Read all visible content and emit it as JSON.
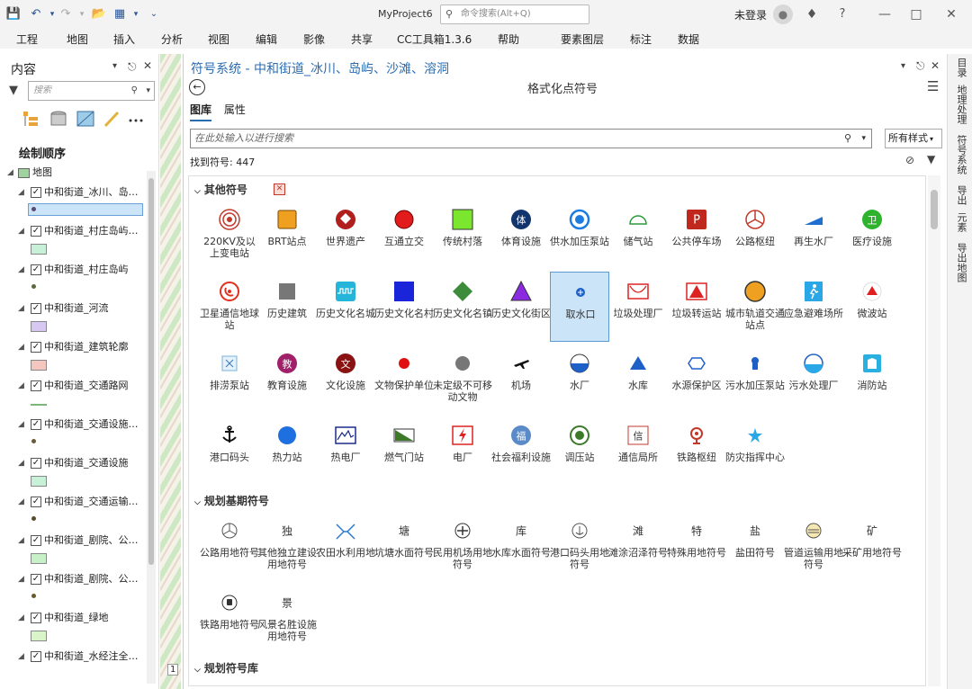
{
  "titlebar": {
    "project": "MyProject6",
    "command_search_placeholder": "命令搜索(Alt+Q)",
    "login": "未登录"
  },
  "ribbon_tabs": [
    "工程",
    "地图",
    "插入",
    "分析",
    "视图",
    "编辑",
    "影像",
    "共享",
    "CC工具箱1.3.6",
    "帮助",
    "要素图层",
    "标注",
    "数据"
  ],
  "left": {
    "title": "内容",
    "search_placeholder": "搜索",
    "draw_order": "绘制顺序",
    "map": "地图",
    "layers": [
      {
        "name": "中和街道_冰川、岛…",
        "kind": "point",
        "selected": true,
        "color": "#5a4a7a"
      },
      {
        "name": "中和街道_村庄岛屿…",
        "kind": "swatch",
        "color": "#c8f0d8"
      },
      {
        "name": "中和街道_村庄岛屿",
        "kind": "point",
        "color": "#5a6a3a"
      },
      {
        "name": "中和街道_河流",
        "kind": "swatch",
        "color": "#d6c8f0"
      },
      {
        "name": "中和街道_建筑轮廓",
        "kind": "swatch",
        "color": "#f4c6c0"
      },
      {
        "name": "中和街道_交通路网",
        "kind": "line",
        "color": "#7ab87a"
      },
      {
        "name": "中和街道_交通设施…",
        "kind": "point",
        "color": "#6a5a3a"
      },
      {
        "name": "中和街道_交通设施",
        "kind": "swatch",
        "color": "#c8f0d8"
      },
      {
        "name": "中和街道_交通运输…",
        "kind": "point",
        "color": "#5a4a2a"
      },
      {
        "name": "中和街道_剧院、公…",
        "kind": "swatch",
        "color": "#c8f0c8"
      },
      {
        "name": "中和街道_剧院、公…",
        "kind": "point",
        "color": "#6a5a2a"
      },
      {
        "name": "中和街道_绿地",
        "kind": "swatch",
        "color": "#d8f4c8"
      },
      {
        "name": "中和街道_水经注全…",
        "kind": "none",
        "color": "#fff"
      }
    ]
  },
  "panel": {
    "title": "符号系统 - 中和街道_冰川、岛屿、沙滩、溶洞",
    "subtitle": "格式化点符号",
    "tabs": [
      "图库",
      "属性"
    ],
    "search_placeholder": "在此处输入以进行搜索",
    "style_filter": "所有样式",
    "found": "找到符号: 447",
    "map_zoom": "1"
  },
  "sections": [
    {
      "title": "其他符号",
      "items": [
        {
          "label": "220KV及以上变电站",
          "icon": "substation-icon"
        },
        {
          "label": "BRT站点",
          "icon": "brt-stop-icon"
        },
        {
          "label": "世界遗产",
          "icon": "world-heritage-icon"
        },
        {
          "label": "互通立交",
          "icon": "interchange-icon"
        },
        {
          "label": "传统村落",
          "icon": "traditional-village-icon"
        },
        {
          "label": "体育设施",
          "icon": "sports-facility-icon",
          "text": "体"
        },
        {
          "label": "供水加压泵站",
          "icon": "water-pump-icon"
        },
        {
          "label": "储气站",
          "icon": "gas-storage-icon"
        },
        {
          "label": "公共停车场",
          "icon": "parking-icon",
          "text": "P"
        },
        {
          "label": "公路枢纽",
          "icon": "highway-hub-icon"
        },
        {
          "label": "再生水厂",
          "icon": "reclaimed-water-icon"
        },
        {
          "label": "医疗设施",
          "icon": "medical-icon",
          "text": "卫"
        },
        {
          "label": "卫星通信地球站",
          "icon": "satellite-station-icon"
        },
        {
          "label": "历史建筑",
          "icon": "historic-building-icon"
        },
        {
          "label": "历史文化名城",
          "icon": "historic-city-icon"
        },
        {
          "label": "历史文化名村",
          "icon": "historic-village-icon"
        },
        {
          "label": "历史文化名镇",
          "icon": "historic-town-icon"
        },
        {
          "label": "历史文化街区",
          "icon": "historic-block-icon"
        },
        {
          "label": "取水口",
          "icon": "water-intake-icon",
          "selected": true
        },
        {
          "label": "垃圾处理厂",
          "icon": "garbage-plant-icon"
        },
        {
          "label": "垃圾转运站",
          "icon": "garbage-transfer-icon"
        },
        {
          "label": "城市轨道交通站点",
          "icon": "metro-station-icon"
        },
        {
          "label": "应急避难场所",
          "icon": "emergency-shelter-icon"
        },
        {
          "label": "微波站",
          "icon": "microwave-station-icon"
        },
        {
          "label": "排涝泵站",
          "icon": "drainage-pump-icon"
        },
        {
          "label": "教育设施",
          "icon": "education-icon",
          "text": "教"
        },
        {
          "label": "文化设施",
          "icon": "culture-icon",
          "text": "文"
        },
        {
          "label": "文物保护单位",
          "icon": "cultural-relic-icon"
        },
        {
          "label": "未定级不可移动文物",
          "icon": "unrated-relic-icon"
        },
        {
          "label": "机场",
          "icon": "airport-icon"
        },
        {
          "label": "水厂",
          "icon": "waterworks-icon"
        },
        {
          "label": "水库",
          "icon": "reservoir-icon"
        },
        {
          "label": "水源保护区",
          "icon": "water-source-protection-icon"
        },
        {
          "label": "污水加压泵站",
          "icon": "sewage-pump-icon"
        },
        {
          "label": "污水处理厂",
          "icon": "sewage-plant-icon"
        },
        {
          "label": "消防站",
          "icon": "fire-station-icon"
        },
        {
          "label": "港口码头",
          "icon": "port-icon"
        },
        {
          "label": "热力站",
          "icon": "heat-station-icon"
        },
        {
          "label": "热电厂",
          "icon": "thermal-plant-icon"
        },
        {
          "label": "燃气门站",
          "icon": "gas-gate-icon"
        },
        {
          "label": "电厂",
          "icon": "power-plant-icon"
        },
        {
          "label": "社会福利设施",
          "icon": "welfare-icon",
          "text": "福"
        },
        {
          "label": "调压站",
          "icon": "pressure-station-icon"
        },
        {
          "label": "通信局所",
          "icon": "telecom-icon",
          "text": "信"
        },
        {
          "label": "铁路枢纽",
          "icon": "railway-hub-icon"
        },
        {
          "label": "防灾指挥中心",
          "icon": "disaster-command-icon"
        }
      ]
    },
    {
      "title": "规划基期符号",
      "items": [
        {
          "label": "公路用地符号",
          "icon": "highway-land-icon"
        },
        {
          "label": "其他独立建设用地符号",
          "icon": "independent-land-icon",
          "text": "独"
        },
        {
          "label": "农田水利用地",
          "icon": "irrigation-land-icon"
        },
        {
          "label": "坑塘水面符号",
          "icon": "pond-icon",
          "text": "塘"
        },
        {
          "label": "民用机场用地符号",
          "icon": "civil-airport-land-icon"
        },
        {
          "label": "水库水面符号",
          "icon": "reservoir-surface-icon",
          "text": "库"
        },
        {
          "label": "港口码头用地符号",
          "icon": "port-land-icon"
        },
        {
          "label": "滩涂沼泽符号",
          "icon": "tidal-flat-icon",
          "text": "滩"
        },
        {
          "label": "特殊用地符号",
          "icon": "special-land-icon",
          "text": "特"
        },
        {
          "label": "盐田符号",
          "icon": "salt-pan-icon",
          "text": "盐"
        },
        {
          "label": "管道运输用地符号",
          "icon": "pipeline-land-icon"
        },
        {
          "label": "采矿用地符号",
          "icon": "mining-land-icon",
          "text": "矿"
        },
        {
          "label": "铁路用地符号",
          "icon": "railway-land-icon"
        },
        {
          "label": "风景名胜设施用地符号",
          "icon": "scenic-land-icon",
          "text": "景"
        }
      ]
    },
    {
      "title": "规划符号库",
      "items": []
    }
  ],
  "right_rail": [
    "目录",
    "地理处理",
    "符号系统",
    "导出",
    "元素",
    "导出地图"
  ]
}
